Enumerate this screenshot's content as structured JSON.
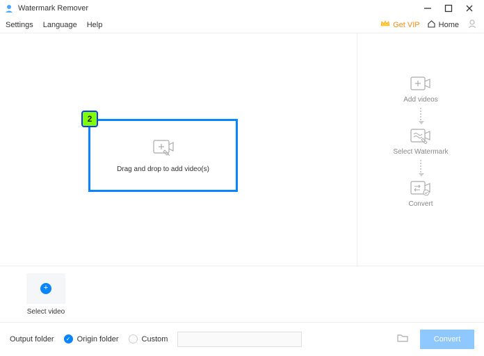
{
  "titlebar": {
    "title": "Watermark Remover"
  },
  "menubar": {
    "settings": "Settings",
    "language": "Language",
    "help": "Help",
    "get_vip": "Get VIP",
    "home": "Home"
  },
  "dropzone": {
    "label": "Drag and drop to add video(s)",
    "badge": "2"
  },
  "steps": {
    "add": "Add videos",
    "select": "Select Watermark",
    "convert": "Convert"
  },
  "queue": {
    "select_video": "Select video"
  },
  "footer": {
    "label": "Output folder",
    "origin": "Origin folder",
    "custom": "Custom",
    "convert": "Convert"
  }
}
